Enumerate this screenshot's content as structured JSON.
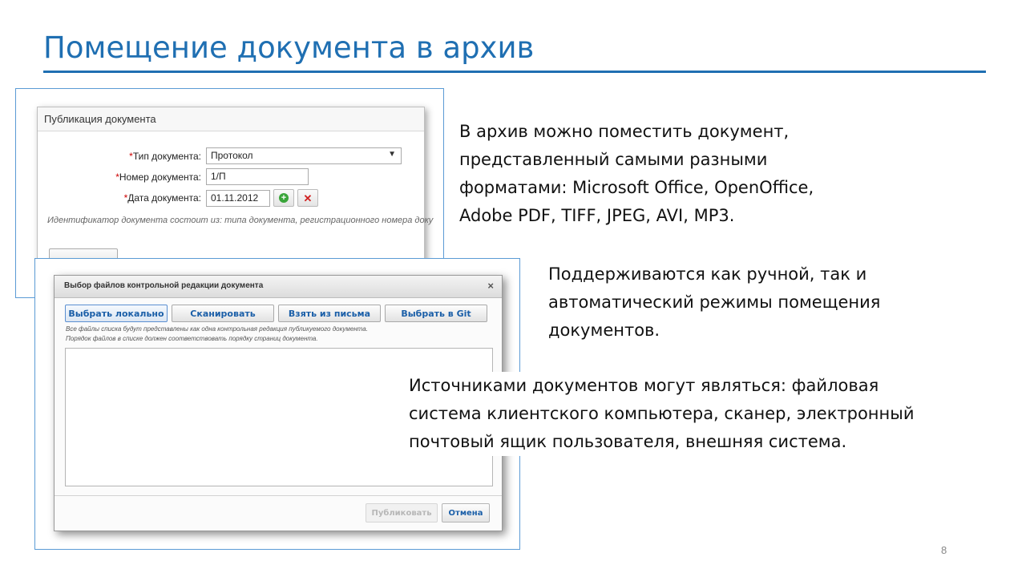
{
  "slide": {
    "title": "Помещение документа в архив",
    "page_number": "8",
    "accent_color": "#1f6fb2"
  },
  "publish_dialog": {
    "title": "Публикация документа",
    "fields": {
      "doc_type": {
        "required_mark": "*",
        "label": "Тип документа:",
        "value": "Протокол"
      },
      "doc_number": {
        "required_mark": "*",
        "label": "Номер документа:",
        "value": "1/П"
      },
      "doc_date": {
        "required_mark": "*",
        "label": "Дата документа:",
        "value": "01.11.2012"
      }
    },
    "hint": "Идентификатор документа состоит из: типа документа, регистрационного номера доку",
    "add_icon": "plus-circle-icon",
    "clear_icon": "close-icon"
  },
  "select_dialog": {
    "title": "Выбор файлов контрольной редакции документа",
    "close_glyph": "×",
    "source_buttons": [
      "Выбрать локально",
      "Сканировать",
      "Взять из письма",
      "Выбрать в Git"
    ],
    "note_line1": "Все файлы списка будут представлены как одна контрольная редакция публикуемого документа.",
    "note_line2": "Порядок файлов в списке должен соответствовать порядку страниц документа.",
    "publish_label": "Публиковать",
    "cancel_label": "Отмена"
  },
  "text_blocks": {
    "formats": [
      "В архив можно поместить документ,",
      "представленный самыми разными",
      "форматами: Microsoft Office, OpenOffice,",
      "Adobe PDF, TIFF, JPEG, AVI, MP3."
    ],
    "modes": [
      "Поддерживаются как ручной, так и",
      "автоматический режимы помещения",
      "документов."
    ],
    "sources": [
      "Источниками документов могут являться: файловая",
      "система клиентского компьютера, сканер, электронный",
      "почтовый ящик пользователя, внешняя система."
    ]
  }
}
